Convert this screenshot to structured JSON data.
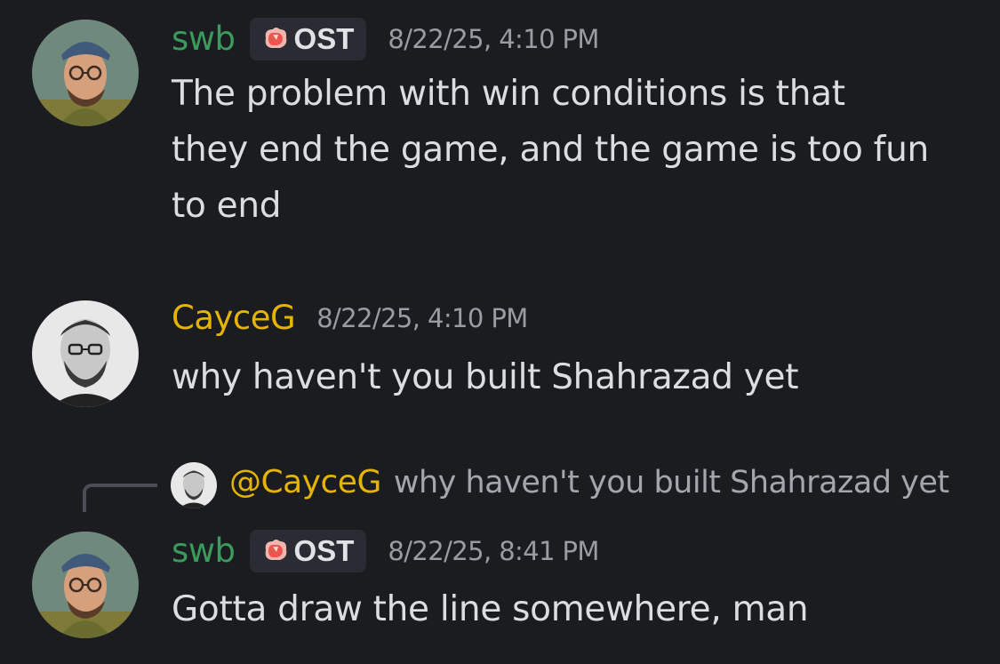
{
  "messages": [
    {
      "username": "swb",
      "tag": "OST",
      "timestamp": "8/22/25, 4:10 PM",
      "lines": [
        "The problem with win conditions is that",
        "they end the game, and the game is too fun",
        "to end"
      ]
    },
    {
      "username": "CayceG",
      "timestamp": "8/22/25, 4:10 PM",
      "lines": [
        "why haven't you built Shahrazad yet"
      ]
    },
    {
      "username": "swb",
      "tag": "OST",
      "timestamp": "8/22/25, 8:41 PM",
      "lines": [
        "Gotta draw the line somewhere, man"
      ],
      "reply_to": {
        "mention": "@CayceG",
        "preview": "why haven't you built Shahrazad yet"
      }
    }
  ],
  "colors": {
    "background": "#1b1c20",
    "swb_name": "#3b9b5c",
    "cayce_name": "#e4b400",
    "tag_bg": "#2b2c33"
  },
  "icons": {
    "tag": "gem-icon"
  }
}
